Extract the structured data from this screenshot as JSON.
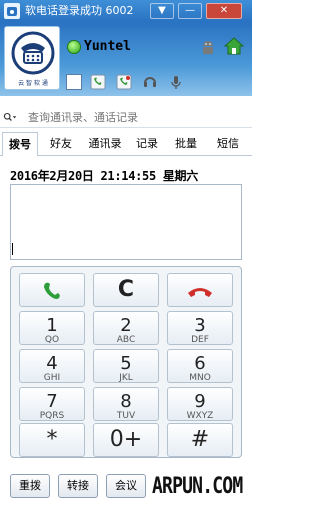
{
  "window": {
    "title": "软电话登录成功 6002",
    "menu_glyph": "▼",
    "minimize_glyph": "—",
    "close_glyph": "✕"
  },
  "header": {
    "logo_caption": "云 智 软 通",
    "username": "Yuntel",
    "status_color": "#3bb526"
  },
  "search": {
    "placeholder": "查询通讯录、通话记录",
    "dropdown_glyph": "▾"
  },
  "tabs": [
    {
      "label": "拨号",
      "active": true
    },
    {
      "label": "好友"
    },
    {
      "label": "通讯录"
    },
    {
      "label": "记录"
    },
    {
      "label": "批量"
    },
    {
      "label": "短信"
    }
  ],
  "datetime": "2016年2月20日  21:14:55  星期六",
  "number_field_value": "",
  "keypad": {
    "call_icon": "phone-green",
    "clear_label": "C",
    "hangup_icon": "phone-red",
    "keys": [
      {
        "digit": "1",
        "letters": "QO"
      },
      {
        "digit": "2",
        "letters": "ABC"
      },
      {
        "digit": "3",
        "letters": "DEF"
      },
      {
        "digit": "4",
        "letters": "GHI"
      },
      {
        "digit": "5",
        "letters": "JKL"
      },
      {
        "digit": "6",
        "letters": "MNO"
      },
      {
        "digit": "7",
        "letters": "PQRS"
      },
      {
        "digit": "8",
        "letters": "TUV"
      },
      {
        "digit": "9",
        "letters": "WXYZ"
      },
      {
        "digit": "*",
        "letters": ""
      },
      {
        "digit": "0+",
        "letters": ""
      },
      {
        "digit": "#",
        "letters": ""
      }
    ]
  },
  "bottom": {
    "redial_label": "重拨",
    "transfer_label": "转接",
    "conference_label": "会议"
  },
  "watermark": "ARPUN.COM",
  "colors": {
    "titlebar": "#2a72c2",
    "call_green": "#2e9e3a",
    "hangup_red": "#d0302a"
  }
}
